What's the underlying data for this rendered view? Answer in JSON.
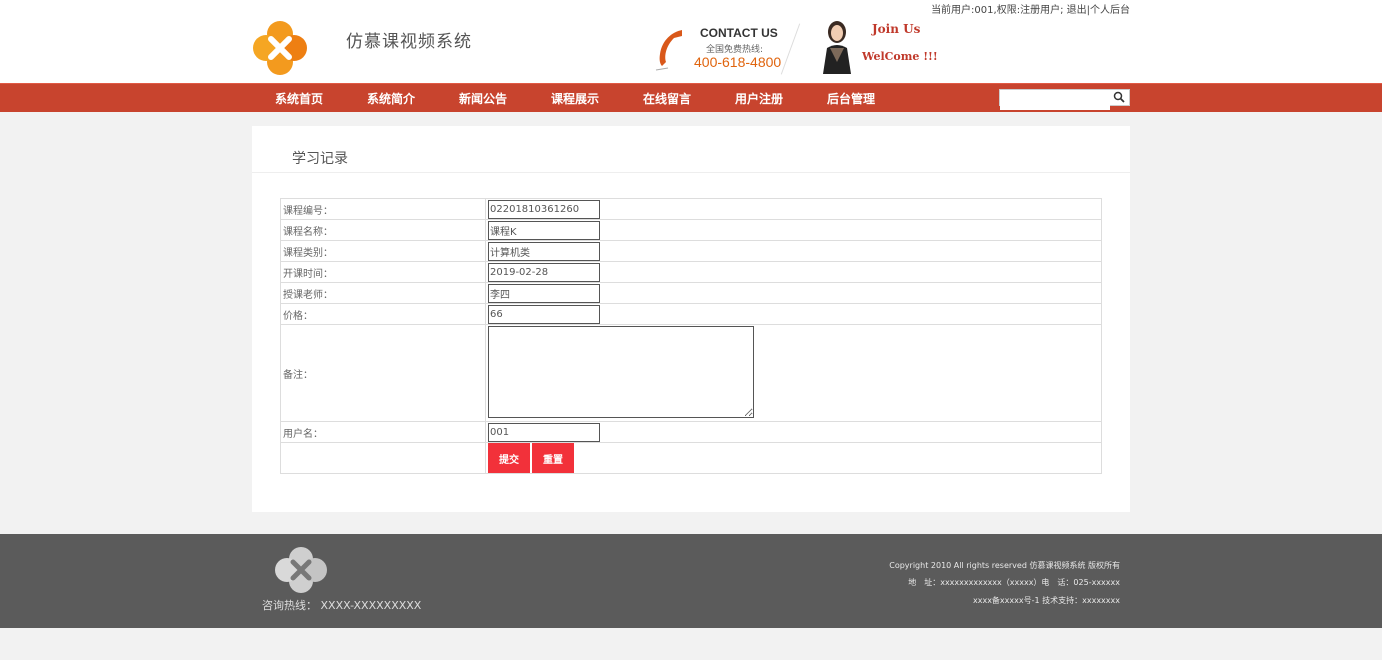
{
  "header": {
    "topbar": {
      "user_info": "当前用户:001,权限:注册用户;",
      "logout": "退出",
      "personal_center": "个人后台",
      "separator": "|"
    },
    "site_title": "仿慕课视频系统",
    "contact": {
      "title": "CONTACT US",
      "subtitle": "全国免费热线:",
      "phone": "400-618-4800"
    },
    "join": "Join Us",
    "welcome": "WelCome !!!"
  },
  "nav": {
    "items": [
      {
        "label": "系统首页"
      },
      {
        "label": "系统简介"
      },
      {
        "label": "新闻公告"
      },
      {
        "label": "课程展示"
      },
      {
        "label": "在线留言"
      },
      {
        "label": "用户注册"
      },
      {
        "label": "后台管理"
      }
    ],
    "search": {
      "value": "",
      "placeholder": ""
    }
  },
  "panel": {
    "title": "学习记录",
    "fields": {
      "course_no": {
        "label": "课程编号：",
        "value": "02201810361260"
      },
      "course_name": {
        "label": "课程名称：",
        "value": "课程K"
      },
      "course_type": {
        "label": "课程类别：",
        "value": "计算机类"
      },
      "start_time": {
        "label": "开课时间：",
        "value": "2019-02-28"
      },
      "teacher": {
        "label": "授课老师：",
        "value": "李四"
      },
      "price": {
        "label": "价格：",
        "value": "66"
      },
      "remark": {
        "label": "备注：",
        "value": ""
      },
      "username": {
        "label": "用户名：",
        "value": "001"
      }
    },
    "buttons": {
      "submit": "提交",
      "reset": "重置"
    }
  },
  "footer": {
    "hotline": "咨询热线： XXXX-XXXXXXXXX",
    "copyright": "Copyright 2010 All rights reserved 仿慕课视频系统 版权所有",
    "address": "地　址：xxxxxxxxxxxxx（xxxxx）电　话：025-xxxxxx",
    "icp": "xxxx备xxxxx号-1 技术支持：xxxxxxxx"
  },
  "colors": {
    "nav_bg": "#c8442e",
    "button_bg": "#f2313a",
    "footer_bg": "#5b5b5b",
    "phone_accent": "#e0640e"
  },
  "icons": {
    "logo": "orange-flower-logo-icon",
    "phone": "phone-handset-icon",
    "search": "search-icon",
    "footer_logo": "gray-flower-logo-icon"
  }
}
